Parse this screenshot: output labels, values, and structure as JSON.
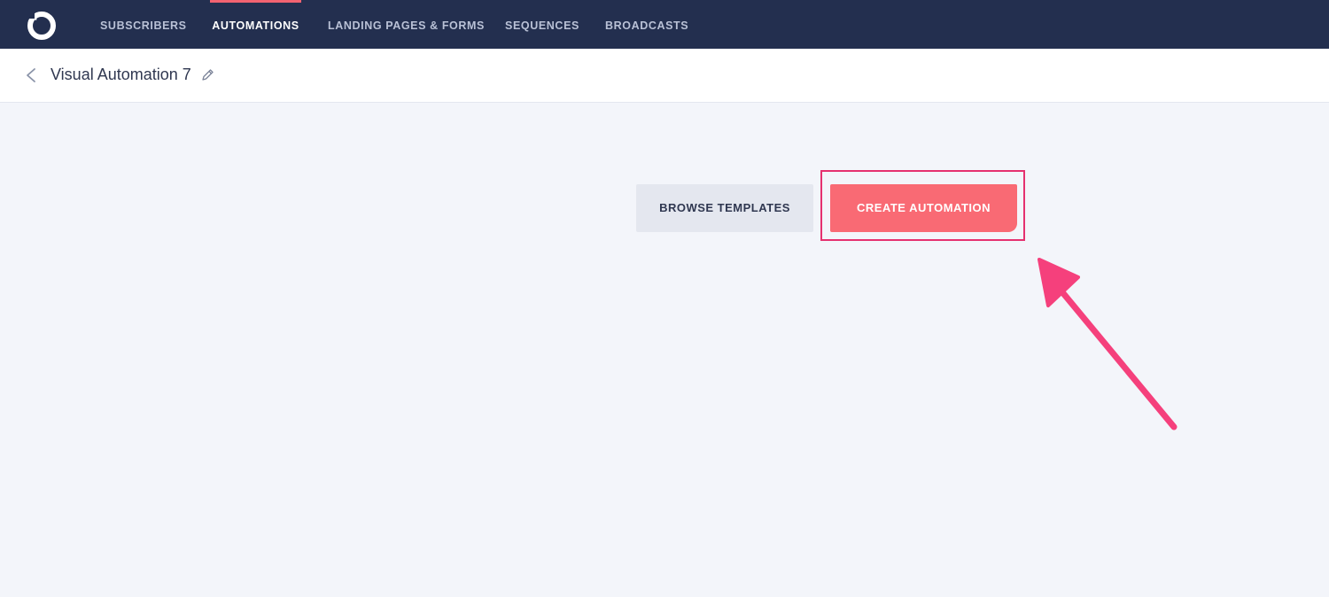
{
  "app": {
    "logo_icon": "convertkit-logo-icon"
  },
  "nav": {
    "items": [
      {
        "label": "SUBSCRIBERS",
        "active": false
      },
      {
        "label": "AUTOMATIONS",
        "active": true
      },
      {
        "label": "LANDING PAGES & FORMS",
        "active": false
      },
      {
        "label": "SEQUENCES",
        "active": false
      },
      {
        "label": "BROADCASTS",
        "active": false
      }
    ]
  },
  "header": {
    "title": "Visual Automation 7",
    "back_icon": "chevron-left-icon",
    "edit_icon": "pencil-icon"
  },
  "actions": {
    "browse_label": "BROWSE TEMPLATES",
    "create_label": "CREATE AUTOMATION"
  },
  "colors": {
    "nav_bg": "#232f4f",
    "accent": "#f26371",
    "create_button": "#f96a74",
    "highlight": "#e5316f",
    "page_bg": "#f3f5fa"
  }
}
